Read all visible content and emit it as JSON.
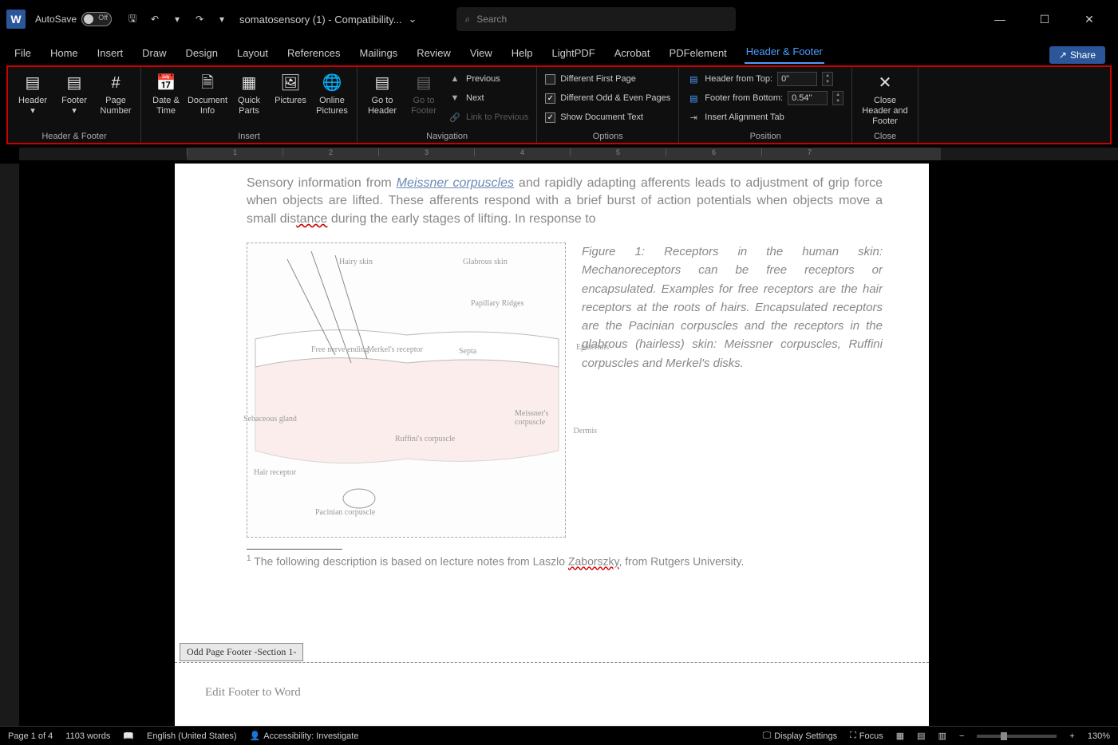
{
  "titlebar": {
    "autosave_label": "AutoSave",
    "toggle_state": "Off",
    "doc_name": "somatosensory (1) - Compatibility...",
    "search_placeholder": "Search"
  },
  "tabs": {
    "file": "File",
    "home": "Home",
    "insert": "Insert",
    "draw": "Draw",
    "design": "Design",
    "layout": "Layout",
    "references": "References",
    "mailings": "Mailings",
    "review": "Review",
    "view": "View",
    "help": "Help",
    "lightpdf": "LightPDF",
    "acrobat": "Acrobat",
    "pdfelement": "PDFelement",
    "header_footer": "Header & Footer",
    "share": "Share"
  },
  "ribbon": {
    "header_footer": {
      "label": "Header & Footer",
      "header": "Header",
      "footer": "Footer",
      "page_number": "Page Number"
    },
    "insert": {
      "label": "Insert",
      "date_time": "Date & Time",
      "doc_info": "Document Info",
      "quick_parts": "Quick Parts",
      "pictures": "Pictures",
      "online_pictures": "Online Pictures"
    },
    "navigation": {
      "label": "Navigation",
      "goto_header": "Go to Header",
      "goto_footer": "Go to Footer",
      "previous": "Previous",
      "next": "Next",
      "link": "Link to Previous"
    },
    "options": {
      "label": "Options",
      "diff_first": "Different First Page",
      "diff_odd_even": "Different Odd & Even Pages",
      "show_doc_text": "Show Document Text"
    },
    "position": {
      "label": "Position",
      "header_top": "Header from Top:",
      "header_top_val": "0\"",
      "footer_bottom": "Footer from Bottom:",
      "footer_bottom_val": "0.54\"",
      "align_tab": "Insert Alignment Tab"
    },
    "close": {
      "label": "Close",
      "close_btn": "Close Header and Footer"
    }
  },
  "document": {
    "body_pre": "Sensory information from ",
    "link_text": "Meissner corpuscles",
    "body_post1": " and rapidly adapting afferents leads to adjustment of grip force when objects are lifted. These afferents respond with a brief burst of action potentials when objects move a small dis",
    "tance": "tance",
    "body_post2": " during the early stages of lifting. In response to",
    "caption": "Figure 1: Receptors in the human skin: Mechanoreceptors can be free receptors or encapsulated. Examples for free receptors are the hair receptors at the roots of hairs. Encapsulated receptors are the Pacinian corpuscles and the receptors in the glabrous (hairless) skin: Meissner corpuscles, Ruffini corpuscles and Merkel's disks.",
    "footnote_pre": "The following description is based on lecture notes from Laszlo ",
    "footnote_link": "Zaborszky",
    "footnote_post": ", from Rutgers University.",
    "footer_tab_label": "Odd Page Footer -Section 1-",
    "footer_text": "Edit Footer to Word",
    "labels": {
      "hairy": "Hairy skin",
      "glabrous": "Glabrous skin",
      "papillary": "Papillary Ridges",
      "epidermis": "Epidermis",
      "dermis": "Dermis",
      "septa": "Septa",
      "free_nerve": "Free nerve ending",
      "merkel": "Merkel's receptor",
      "meissner": "Meissner's corpuscle",
      "sebaceous": "Sebaceous gland",
      "ruffini": "Ruffini's corpuscle",
      "hair_receptor": "Hair receptor",
      "pacinian": "Pacinian corpuscle"
    }
  },
  "statusbar": {
    "page": "Page 1 of 4",
    "words": "1103 words",
    "language": "English (United States)",
    "accessibility": "Accessibility: Investigate",
    "display_settings": "Display Settings",
    "focus": "Focus",
    "zoom": "130%"
  }
}
